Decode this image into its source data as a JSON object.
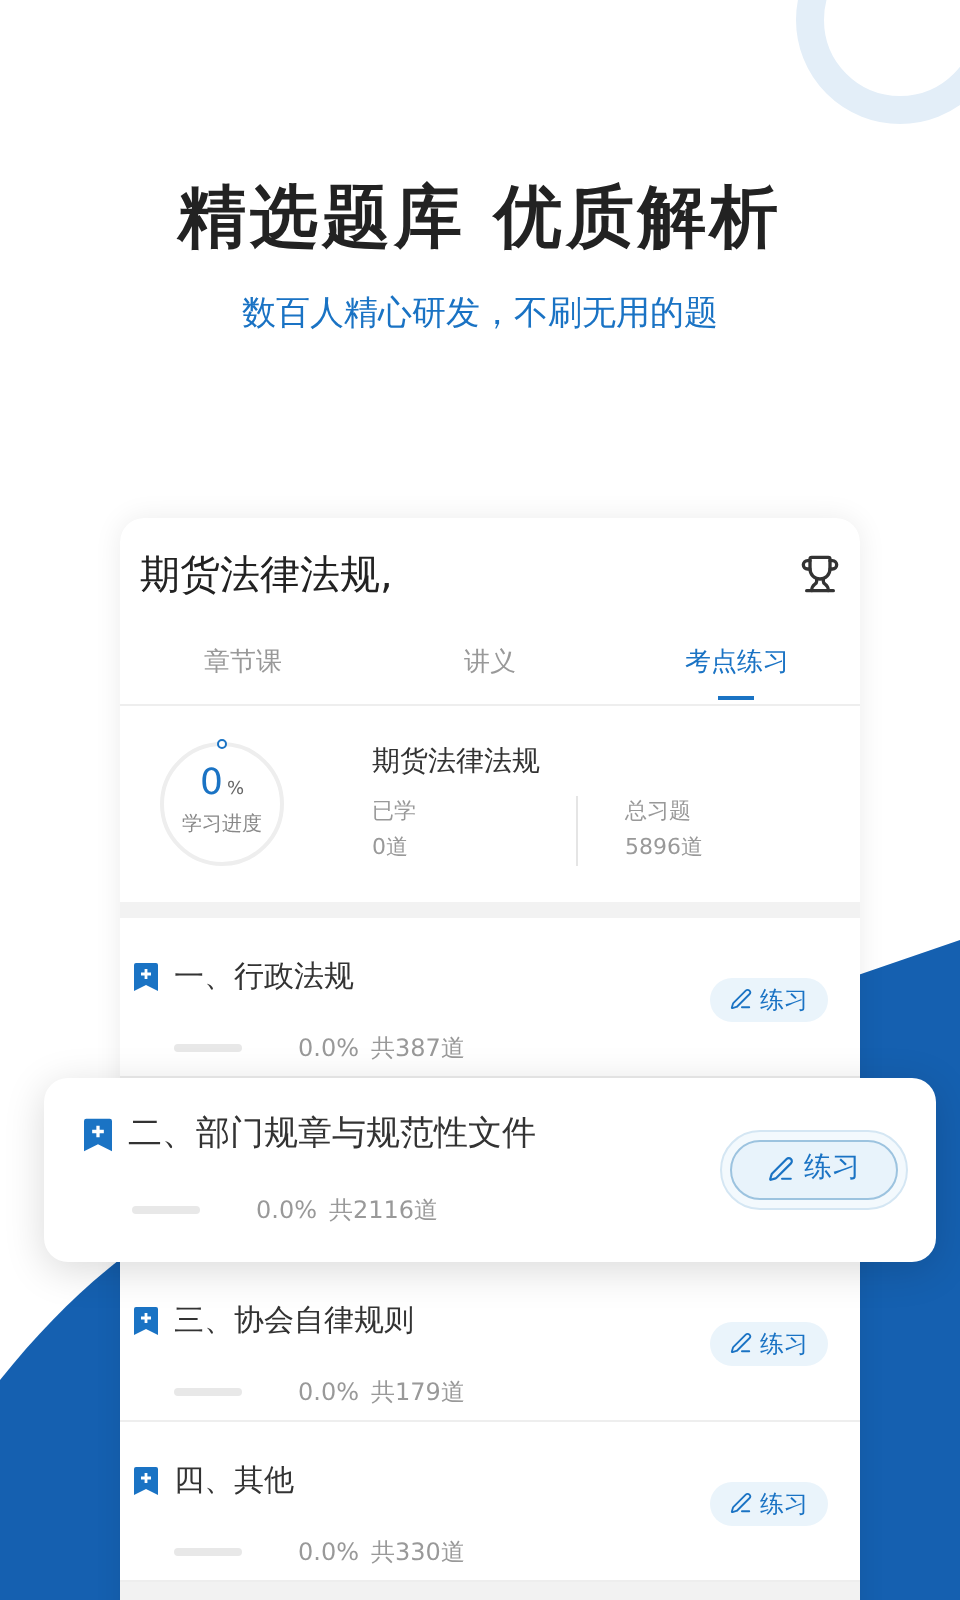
{
  "headline": "精选题库 优质解析",
  "subheadline": "数百人精心研发，不刷无用的题",
  "card": {
    "title": "期货法律法规,",
    "tabs": [
      {
        "label": "章节课",
        "selected": false
      },
      {
        "label": "讲义",
        "selected": false
      },
      {
        "label": "考点练习",
        "selected": true
      }
    ],
    "summary": {
      "progress_value": "0",
      "progress_unit": "%",
      "progress_label": "学习进度",
      "level": 0,
      "subject": "期货法律法规",
      "stats": [
        {
          "label": "已学",
          "value": "0道"
        },
        {
          "label": "总习题",
          "value": "5896道"
        }
      ]
    },
    "chapters": [
      {
        "title": "一、行政法规",
        "level": 0,
        "percent": "0.0%",
        "total": "共387道",
        "button": "练习",
        "highlighted": false
      },
      {
        "title": "二、部门规章与规范性文件",
        "level": 0,
        "percent": "0.0%",
        "total": "共2116道",
        "button": "练习",
        "highlighted": true
      },
      {
        "title": "三、协会自律规则",
        "level": 0,
        "percent": "0.0%",
        "total": "共179道",
        "button": "练习",
        "highlighted": false
      },
      {
        "title": "四、其他",
        "level": 0,
        "percent": "0.0%",
        "total": "共330道",
        "button": "练习",
        "highlighted": false
      }
    ]
  }
}
